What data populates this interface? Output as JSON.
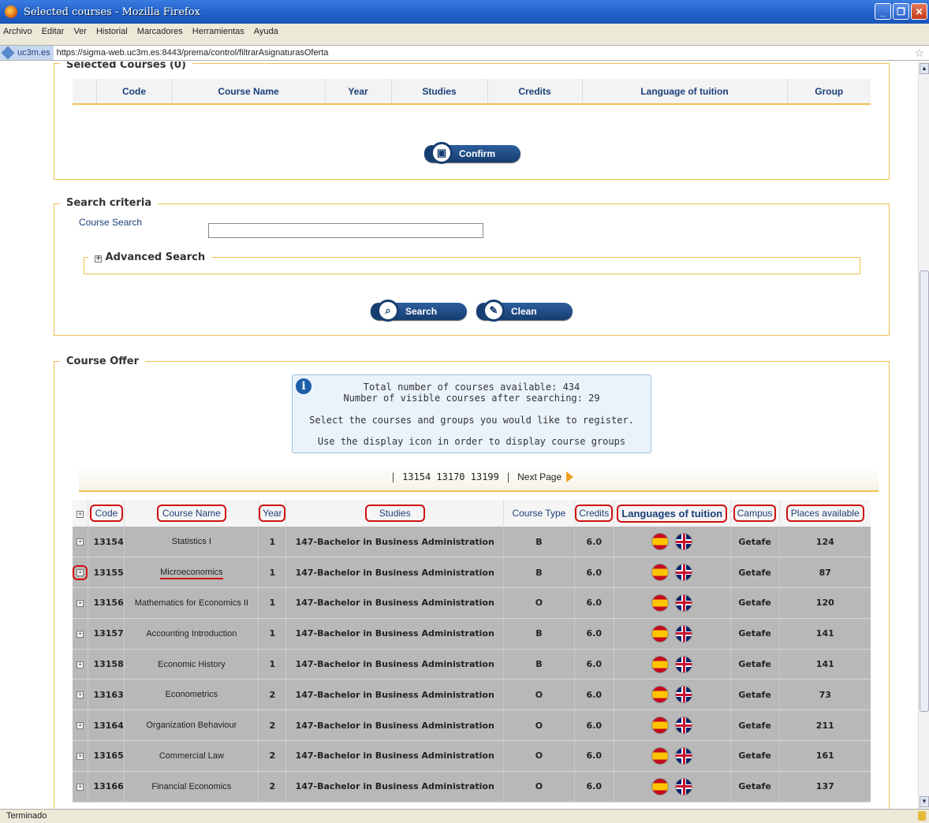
{
  "window": {
    "title": "Selected courses  - Mozilla Firefox"
  },
  "menu": [
    "Archivo",
    "Editar",
    "Ver",
    "Historial",
    "Marcadores",
    "Herramientas",
    "Ayuda"
  ],
  "url": {
    "site": "uc3m.es",
    "address": "https://sigma-web.uc3m.es:8443/prema/control/filtrarAsignaturasOferta"
  },
  "selected": {
    "legend": "Selected Courses (0)",
    "headers": [
      "Code",
      "Course Name",
      "Year",
      "Studies",
      "Credits",
      "Language of tuition",
      "Group"
    ],
    "confirm_label": "Confirm"
  },
  "search": {
    "legend": "Search criteria",
    "course_search_label": "Course Search",
    "course_search_value": "",
    "advanced_label": "Advanced Search",
    "search_label": "Search",
    "clean_label": "Clean"
  },
  "offer": {
    "legend": "Course Offer",
    "info_total": "Total number of courses available: 434",
    "info_visible": "Number of visible courses after searching: 29",
    "info_select": "Select the courses and groups you would like to register.",
    "info_display": "Use the display icon in order to display course groups",
    "pages": "13154 13170 13199",
    "next_label": "Next Page",
    "headers": {
      "code": "Code",
      "name": "Course Name",
      "year": "Year",
      "studies": "Studies",
      "type": "Course Type",
      "credits": "Credits",
      "languages": "Languages of tuition",
      "campus": "Campus",
      "places": "Places available"
    },
    "rows": [
      {
        "code": "13154",
        "name": "Statistics I",
        "year": "1",
        "studies": "147-Bachelor in Business Administration",
        "type": "B",
        "credits": "6.0",
        "campus": "Getafe",
        "places": "124"
      },
      {
        "code": "13155",
        "name": "Microeconomics",
        "year": "1",
        "studies": "147-Bachelor in Business Administration",
        "type": "B",
        "credits": "6.0",
        "campus": "Getafe",
        "places": "87"
      },
      {
        "code": "13156",
        "name": "Mathematics for Economics II",
        "year": "1",
        "studies": "147-Bachelor in Business Administration",
        "type": "O",
        "credits": "6.0",
        "campus": "Getafe",
        "places": "120"
      },
      {
        "code": "13157",
        "name": "Accounting Introduction",
        "year": "1",
        "studies": "147-Bachelor in Business Administration",
        "type": "B",
        "credits": "6.0",
        "campus": "Getafe",
        "places": "141"
      },
      {
        "code": "13158",
        "name": "Economic History",
        "year": "1",
        "studies": "147-Bachelor in Business Administration",
        "type": "B",
        "credits": "6.0",
        "campus": "Getafe",
        "places": "141"
      },
      {
        "code": "13163",
        "name": "Econometrics",
        "year": "2",
        "studies": "147-Bachelor in Business Administration",
        "type": "O",
        "credits": "6.0",
        "campus": "Getafe",
        "places": "73"
      },
      {
        "code": "13164",
        "name": "Organization Behaviour",
        "year": "2",
        "studies": "147-Bachelor in Business Administration",
        "type": "O",
        "credits": "6.0",
        "campus": "Getafe",
        "places": "211"
      },
      {
        "code": "13165",
        "name": "Commercial Law",
        "year": "2",
        "studies": "147-Bachelor in Business Administration",
        "type": "O",
        "credits": "6.0",
        "campus": "Getafe",
        "places": "161"
      },
      {
        "code": "13166",
        "name": "Financial Economics",
        "year": "2",
        "studies": "147-Bachelor in Business Administration",
        "type": "O",
        "credits": "6.0",
        "campus": "Getafe",
        "places": "137"
      }
    ]
  },
  "status": {
    "text": "Terminado"
  },
  "colors": {
    "accent_border": "#f0c050",
    "button": "#163e70",
    "highlight": "#d01010",
    "row_bg": "#b8b8b8"
  }
}
